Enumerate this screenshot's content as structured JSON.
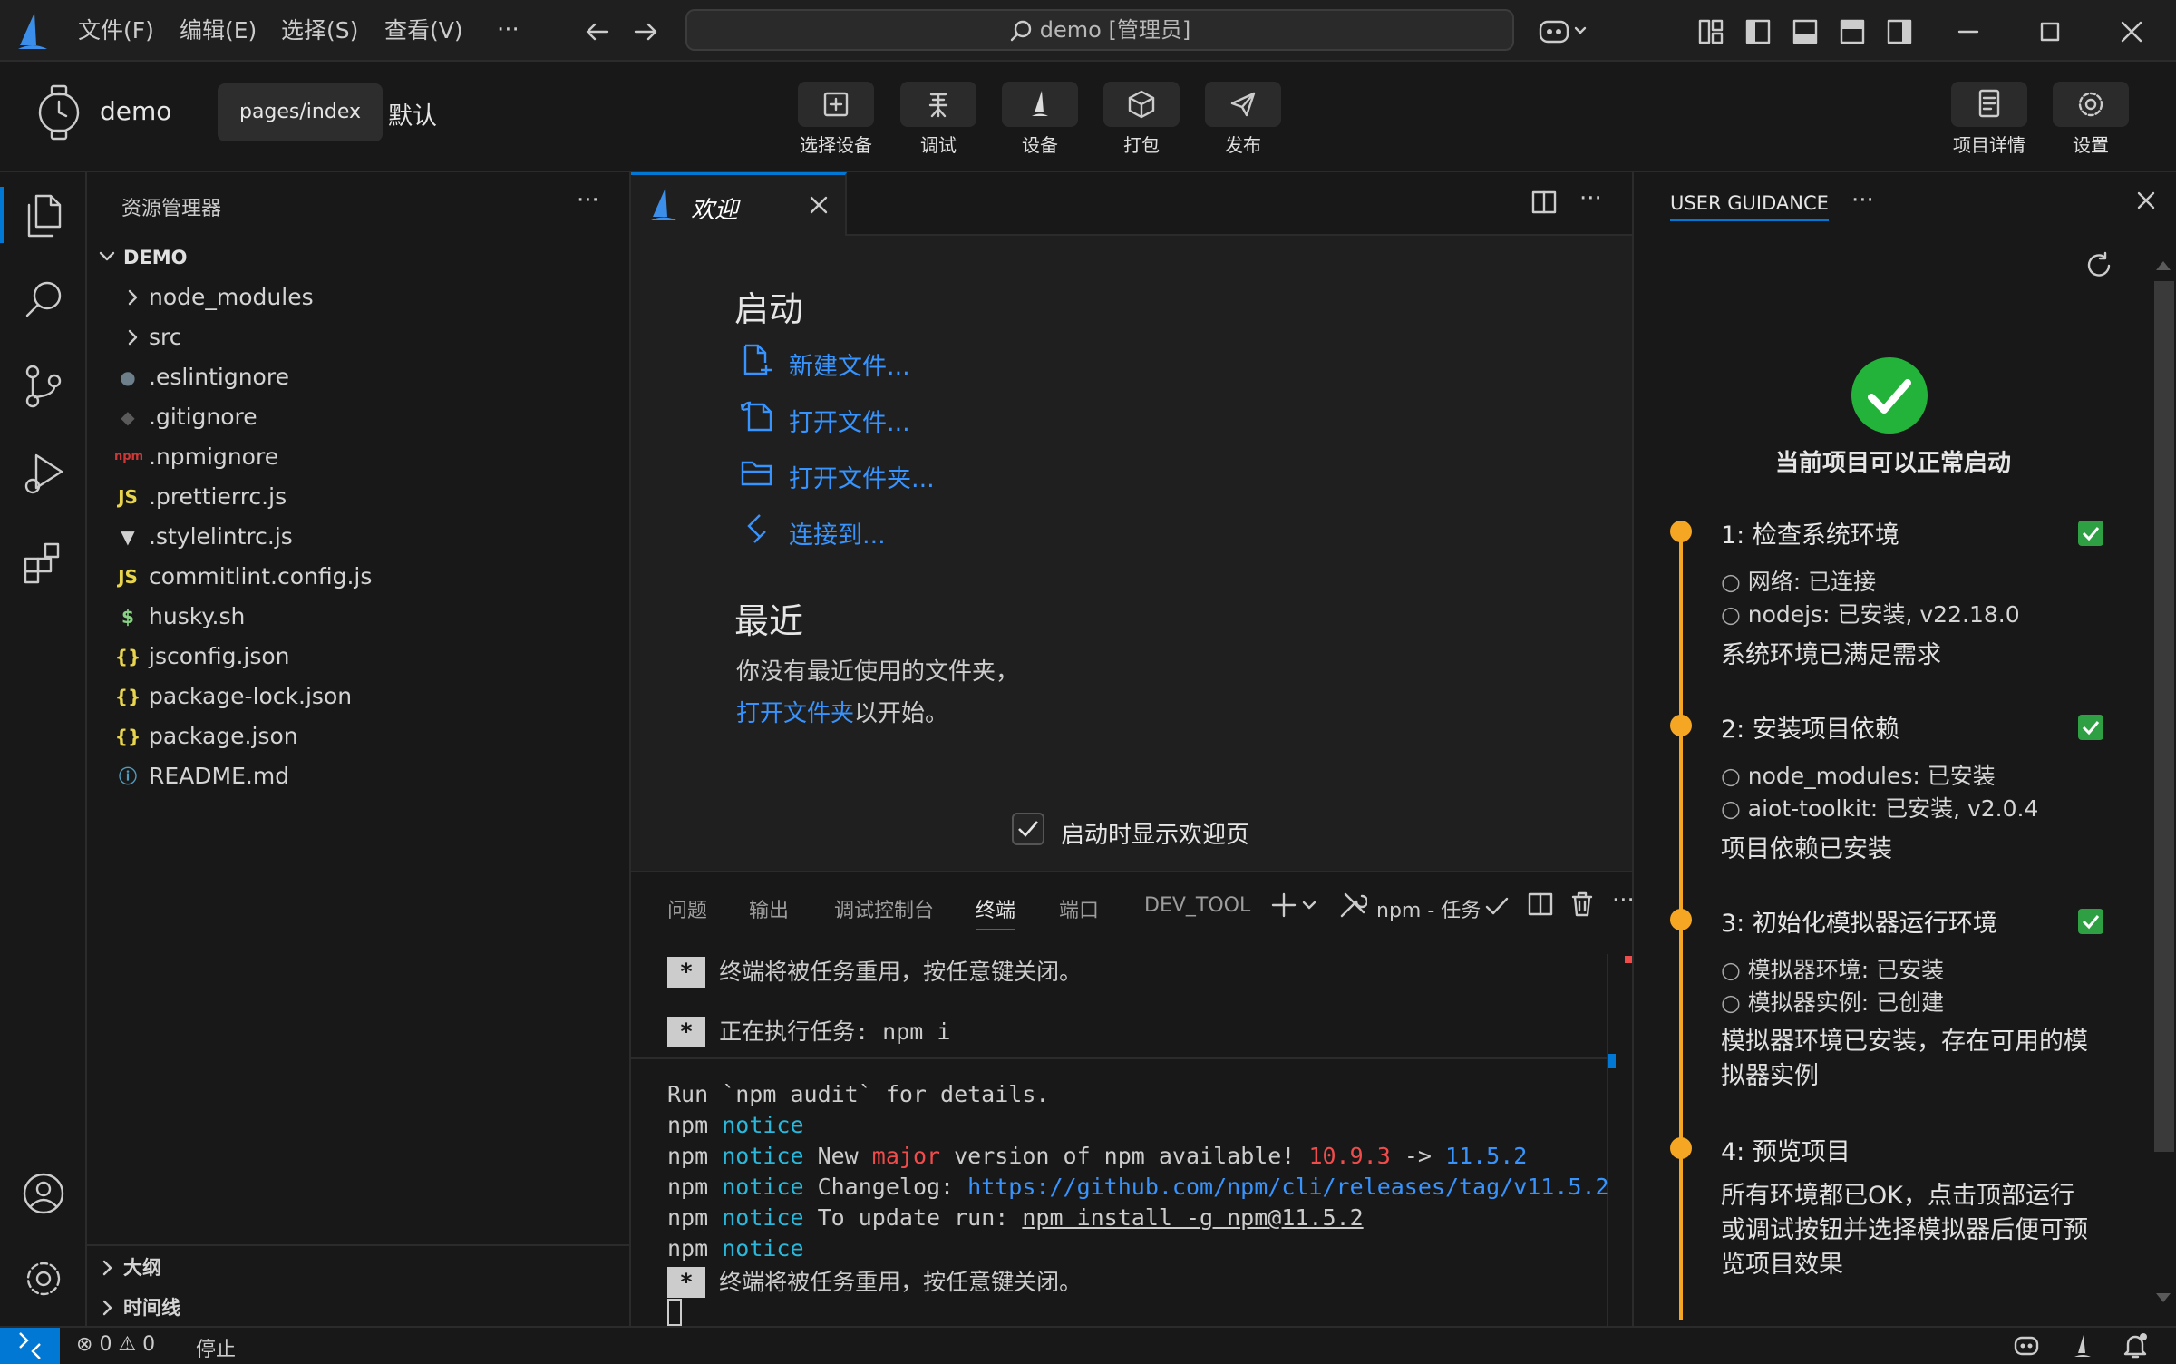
{
  "menu": [
    "文件(F)",
    "编辑(E)",
    "选择(S)",
    "查看(V)"
  ],
  "search": {
    "text": "demo [管理员]"
  },
  "project": {
    "name": "demo",
    "page_button": "pages/index",
    "mode": "默认"
  },
  "toolbar": {
    "select_device": "选择设备",
    "debug": "调试",
    "device": "设备",
    "pack": "打包",
    "publish": "发布",
    "project_details": "项目详情",
    "settings": "设置"
  },
  "explorer": {
    "title": "资源管理器",
    "root": "DEMO",
    "items": [
      {
        "label": "node_modules",
        "type": "folder"
      },
      {
        "label": "src",
        "type": "folder"
      },
      {
        "label": ".eslintignore",
        "type": "file",
        "icon": "●",
        "color": "#6d7f8a"
      },
      {
        "label": ".gitignore",
        "type": "file",
        "icon": "◆",
        "color": "#5a5a5a"
      },
      {
        "label": ".npmignore",
        "type": "file",
        "icon": "npm",
        "color": "#cb3837"
      },
      {
        "label": ".prettierrc.js",
        "type": "file",
        "icon": "JS",
        "color": "#e8d44d"
      },
      {
        "label": ".stylelintrc.js",
        "type": "file",
        "icon": "▼",
        "color": "#d0d0d0"
      },
      {
        "label": "commitlint.config.js",
        "type": "file",
        "icon": "JS",
        "color": "#e8d44d"
      },
      {
        "label": "husky.sh",
        "type": "file",
        "icon": "$",
        "color": "#89d185"
      },
      {
        "label": "jsconfig.json",
        "type": "file",
        "icon": "{}",
        "color": "#e8d44d"
      },
      {
        "label": "package-lock.json",
        "type": "file",
        "icon": "{}",
        "color": "#e8d44d"
      },
      {
        "label": "package.json",
        "type": "file",
        "icon": "{}",
        "color": "#e8d44d"
      },
      {
        "label": "README.md",
        "type": "file",
        "icon": "ⓘ",
        "color": "#519aba"
      }
    ],
    "outline": "大纲",
    "timeline": "时间线"
  },
  "editor": {
    "tab_label": "欢迎",
    "start_heading": "启动",
    "new_file": "新建文件...",
    "open_file": "打开文件...",
    "open_folder": "打开文件夹...",
    "connect": "连接到...",
    "recent_heading": "最近",
    "recent_text": "你没有最近使用的文件夹，",
    "recent_link": "打开文件夹",
    "recent_suffix": "以开始。",
    "show_on_startup": "启动时显示欢迎页"
  },
  "panel": {
    "tabs": [
      "问题",
      "输出",
      "调试控制台",
      "终端",
      "端口",
      "DEV_TOOL"
    ],
    "task_label": "npm - 任务"
  },
  "terminal": {
    "line1": "终端将被任务重用，按任意键关闭。",
    "line2": "正在执行任务: npm i",
    "audit": "Run `npm audit` for details.",
    "npm": "npm",
    "notice": "notice",
    "new_version_a": " New ",
    "major": "major",
    "new_version_b": " version of npm available! ",
    "old_ver": "10.9.3",
    "arrow": " -> ",
    "new_ver": "11.5.2",
    "changelog_label": " Changelog: ",
    "changelog_url": "https://github.com/npm/cli/releases/tag/v11.5.2",
    "update_label": " To update run: ",
    "update_cmd": "npm install -g npm@11.5.2",
    "line_end": "终端将被任务重用，按任意键关闭。"
  },
  "guidance": {
    "tab": "USER GUIDANCE",
    "status_text": "当前项目可以正常启动",
    "steps": [
      {
        "title": "1: 检查系统环境",
        "items": [
          "网络: 已连接",
          "nodejs: 已安装, v22.18.0"
        ],
        "desc": "系统环境已满足需求"
      },
      {
        "title": "2: 安装项目依赖",
        "items": [
          "node_modules: 已安装",
          "aiot-toolkit: 已安装, v2.0.4"
        ],
        "desc": "项目依赖已安装"
      },
      {
        "title": "3: 初始化模拟器运行环境",
        "items": [
          "模拟器环境: 已安装",
          "模拟器实例: 已创建"
        ],
        "desc_l1": "模拟器环境已安装，存在可用的模",
        "desc_l2": "拟器实例"
      },
      {
        "title": "4: 预览项目",
        "desc_l1": "所有环境都已OK，点击顶部运行",
        "desc_l2": "或调试按钮并选择模拟器后便可预",
        "desc_l3": "览项目效果"
      }
    ]
  },
  "status": {
    "errors": "0",
    "warnings": "0",
    "stop": "停止"
  },
  "colors": {
    "accent": "#0078d4",
    "link": "#3794ff",
    "success": "#2ea043",
    "step_dot": "#f5a623"
  }
}
